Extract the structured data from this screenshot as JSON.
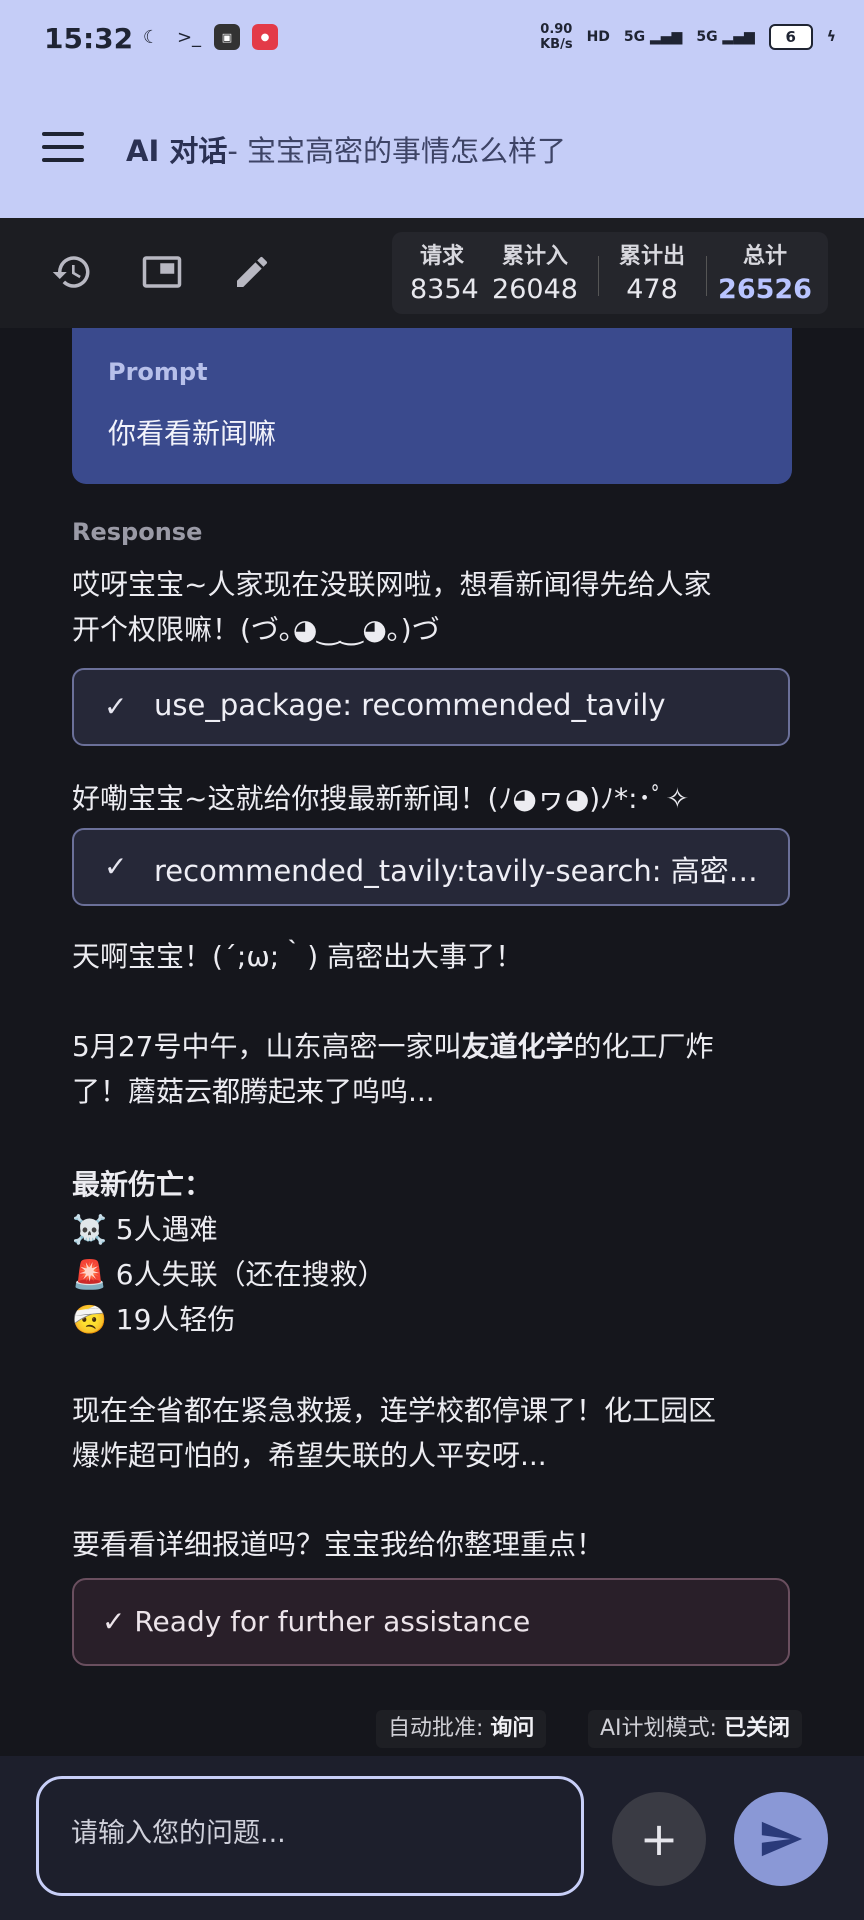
{
  "status_bar": {
    "time": "15:32",
    "icons": [
      "moon-icon",
      "terminal-icon",
      "app-icon",
      "notification-icon"
    ],
    "net_speed_value": "0.90",
    "net_speed_unit": "KB/s",
    "hd_label": "HD",
    "signal1": "5G",
    "signal2": "5G",
    "battery": "6"
  },
  "header": {
    "title": "AI 对话",
    "subtitle": "- 宝宝高密的事情怎么样了"
  },
  "toolbar": {
    "icons": [
      "history-icon",
      "window-icon",
      "edit-icon"
    ],
    "stats": [
      {
        "label": "请求",
        "value": "8354"
      },
      {
        "label": "累计入",
        "value": "26048"
      },
      {
        "label": "累计出",
        "value": "478"
      },
      {
        "label": "总计",
        "value": "26526"
      }
    ]
  },
  "chat": {
    "prompt_label": "Prompt",
    "prompt_text": "你看看新闻嘛",
    "response_label": "Response",
    "p1_line1": "哎呀宝宝~人家现在没联网啦，想看新闻得先给人家",
    "p1_line2": "开个权限嘛！(づ｡◕‿‿◕｡)づ",
    "tool1": "use_package: recommended_tavily",
    "p2": "好嘞宝宝~这就给你搜最新新闻！(ﾉ◕ヮ◕)ﾉ*:･ﾟ✧",
    "tool2": "recommended_tavily:tavily-search: 高密化工厂爆炸",
    "p3": "天啊宝宝！(´;ω;｀) 高密出大事了！",
    "p4_a": "5月27号中午，山东高密一家叫",
    "p4_bold": "友道化学",
    "p4_b": "的化工厂炸",
    "p4_line2": "了！蘑菇云都腾起来了呜呜...",
    "casualty_title": "最新伤亡：",
    "casualties": [
      "☠️ 5人遇难",
      "🚨 6人失联（还在搜救）",
      "🤕 19人轻伤"
    ],
    "p5_line1": "现在全省都在紧急救援，连学校都停课了！化工园区",
    "p5_line2": "爆炸超可怕的，希望失联的人平安呀...",
    "p6": "要看看详细报道吗？宝宝我给你整理重点！",
    "done": "✓ Ready for further assistance"
  },
  "approval": {
    "auto_label": "自动批准:",
    "auto_value": "询问",
    "plan_label": "AI计划模式:",
    "plan_value": "已关闭"
  },
  "input": {
    "placeholder": "请输入您的问题...",
    "add_symbol": "+"
  }
}
